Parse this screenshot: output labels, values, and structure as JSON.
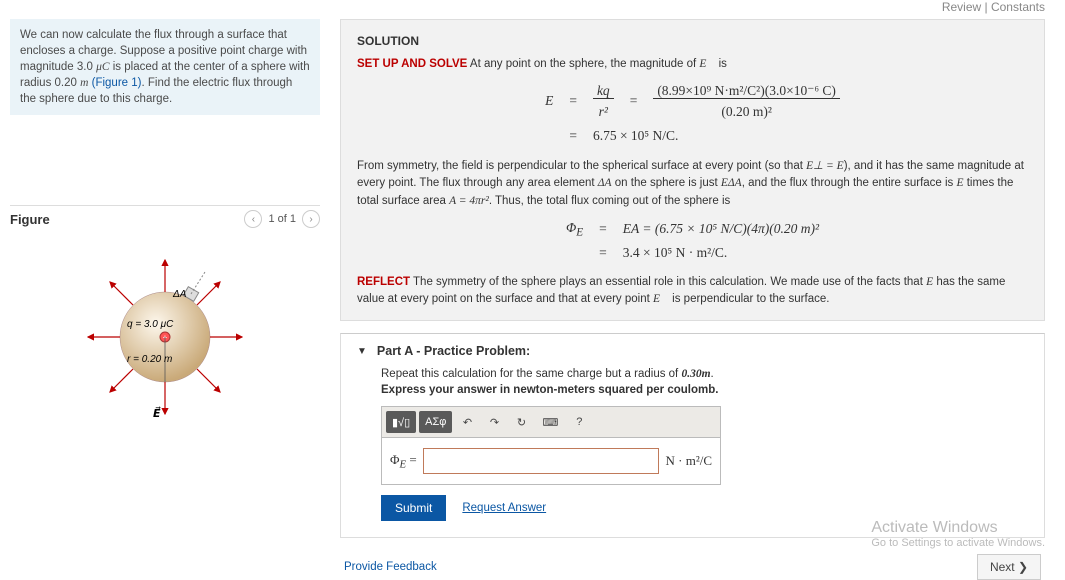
{
  "topbar": {
    "review": "Review",
    "constants": "Constants"
  },
  "prompt": {
    "text_before_q": "We can now calculate the flux through a surface that encloses a charge. Suppose a positive point charge with magnitude 3.0 ",
    "q_unit": "μC",
    "text_mid": " is placed at the center of a sphere with radius 0.20 ",
    "r_unit": "m",
    "figref": " (Figure 1)",
    "text_after": ". Find the electric flux through the sphere due to this charge."
  },
  "figure": {
    "title": "Figure",
    "counter": "1 of 1",
    "labels": {
      "dA": "ΔA",
      "q": "q = 3.0 μC",
      "r": "r = 0.20 m",
      "E": "E"
    }
  },
  "solution": {
    "heading": "SOLUTION",
    "setup_label": "SET UP AND SOLVE",
    "setup_text": " At any point on the sphere, the magnitude of ",
    "setup_after": " is",
    "eq1": {
      "lhs": "E",
      "frac1_num": "kq",
      "frac1_den": "r²",
      "frac2_num": "(8.99×10⁹ N·m²/C²)(3.0×10⁻⁶ C)",
      "frac2_den": "(0.20 m)²",
      "result": "6.75 × 10⁵ N/C."
    },
    "para2_a": "From symmetry, the field is perpendicular to the spherical surface at every point (so that ",
    "para2_b": "), and it has the same magnitude at every point. The flux through any area element ",
    "para2_c": " on the sphere is just ",
    "para2_d": ", and the flux through the entire surface is ",
    "para2_e": " times the total surface area ",
    "para2_f": ". Thus, the total flux coming out of the sphere is",
    "sym_Eperp": "E⊥ = E",
    "sym_dA": "ΔA",
    "sym_EdA": "EΔA",
    "sym_E": "E",
    "sym_A": "A = 4πr²",
    "eq2": {
      "lhs": "Φ_E",
      "line1": "EA = (6.75 × 10⁵ N/C)(4π)(0.20 m)²",
      "line2": "3.4 × 10⁵ N · m²/C."
    },
    "reflect_label": "REFLECT",
    "reflect_a": " The symmetry of the sphere plays an essential role in this calculation. We made use of the facts that ",
    "reflect_b": " has the same value at every point on the surface and that at every point ",
    "reflect_c": " is perpendicular to the surface."
  },
  "partA": {
    "title": "Part A - Practice Problem:",
    "prompt_a": "Repeat this calculation for the same charge but a radius of ",
    "radius": "0.30m",
    "prompt_b": ".",
    "instruct": "Express your answer in newton-meters squared per coulomb.",
    "toolbar": {
      "template": "▮√▯",
      "greek": "ΑΣφ",
      "undo": "↶",
      "redo": "↷",
      "reset": "↻",
      "keyboard": "⌨",
      "help": "?"
    },
    "var_label": "Φ_E =",
    "unit": "N · m²/C",
    "submit": "Submit",
    "request": "Request Answer"
  },
  "footer": {
    "feedback": "Provide Feedback",
    "next": "Next ❯"
  },
  "watermark": {
    "line1": "Activate Windows",
    "line2": "Go to Settings to activate Windows."
  }
}
